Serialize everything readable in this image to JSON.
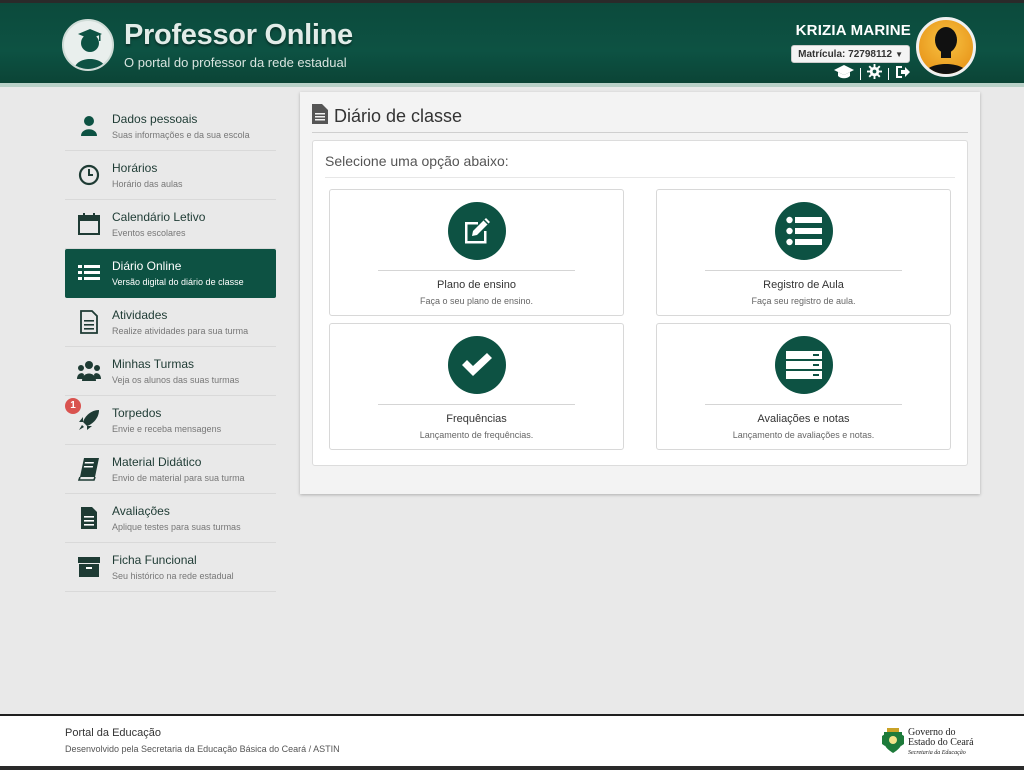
{
  "header": {
    "title": "Professor Online",
    "subtitle": "O portal do professor da rede estadual",
    "user_name": "KRIZIA MARINE",
    "matricula": "Matrícula: 72798112",
    "icons": [
      "graduation-cap-icon",
      "gear-icon",
      "sign-out-icon"
    ]
  },
  "sidebar": {
    "items": [
      {
        "label": "Dados pessoais",
        "desc": "Suas informações e da sua escola",
        "icon": "user-icon"
      },
      {
        "label": "Horários",
        "desc": "Horário das aulas",
        "icon": "clock-icon"
      },
      {
        "label": "Calendário Letivo",
        "desc": "Eventos escolares",
        "icon": "calendar-icon"
      },
      {
        "label": "Diário Online",
        "desc": "Versão digital do diário de classe",
        "icon": "list-icon",
        "active": true
      },
      {
        "label": "Atividades",
        "desc": "Realize atividades para sua turma",
        "icon": "document-icon"
      },
      {
        "label": "Minhas Turmas",
        "desc": "Veja os alunos das suas turmas",
        "icon": "users-icon"
      },
      {
        "label": "Torpedos",
        "desc": "Envie e receba mensagens",
        "icon": "rocket-icon",
        "badge": "1"
      },
      {
        "label": "Material Didático",
        "desc": "Envio de material para sua turma",
        "icon": "book-icon"
      },
      {
        "label": "Avaliações",
        "desc": "Aplique testes para suas turmas",
        "icon": "file-text-icon"
      },
      {
        "label": "Ficha Funcional",
        "desc": "Seu histórico na rede estadual",
        "icon": "archive-icon"
      }
    ]
  },
  "main": {
    "title": "Diário de classe",
    "prompt": "Selecione uma opção abaixo:",
    "cards": [
      {
        "title": "Plano de ensino",
        "desc": "Faça o seu plano de ensino.",
        "icon": "edit-icon"
      },
      {
        "title": "Registro de Aula",
        "desc": "Faça seu registro de aula.",
        "icon": "list-icon"
      },
      {
        "title": "Frequências",
        "desc": "Lançamento de frequências.",
        "icon": "check-icon"
      },
      {
        "title": "Avaliações e notas",
        "desc": "Lançamento de avaliações e notas.",
        "icon": "server-icon"
      }
    ]
  },
  "footer": {
    "title": "Portal da Educação",
    "subtitle": "Desenvolvido pela Secretaria da Educação Básica do Ceará / ASTIN",
    "gov_line1": "Governo do",
    "gov_line2": "Estado do Ceará",
    "gov_line3": "Secretaria da Educação"
  },
  "colors": {
    "brand": "#0d5243",
    "header_band": "#b9d1c8",
    "badge": "#d9534f"
  }
}
